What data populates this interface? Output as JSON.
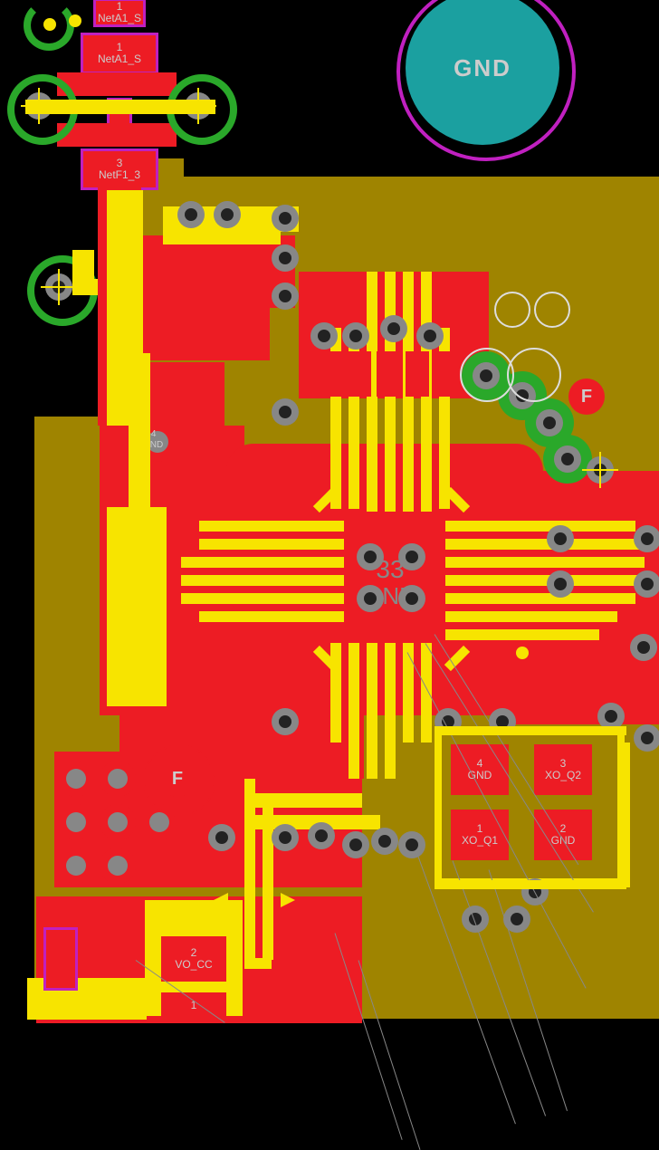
{
  "big_pad": {
    "label": "GND"
  },
  "top_conn": {
    "pad_top": {
      "num": "1",
      "net": "NetA1_S"
    },
    "pad_mid": {
      "num": "1",
      "net": "NetA1_S"
    },
    "pad_bottom": {
      "num": "3",
      "net": "NetF1_3"
    }
  },
  "ic": {
    "center_pad": {
      "num": "33",
      "net": "GND"
    },
    "small_via": {
      "num": "1-4",
      "net": "GND"
    }
  },
  "osc": {
    "p1": {
      "num": "1",
      "net": "XO_Q1"
    },
    "p2": {
      "num": "2",
      "net": "GND"
    },
    "p3": {
      "num": "3",
      "net": "XO_Q2"
    },
    "p4": {
      "num": "4",
      "net": "GND"
    }
  },
  "bottom_conn": {
    "p2": {
      "num": "2",
      "net": "VO_CC"
    },
    "p1": {
      "num": "1"
    }
  },
  "fiducials": {
    "f1": "F",
    "f2": "F"
  }
}
